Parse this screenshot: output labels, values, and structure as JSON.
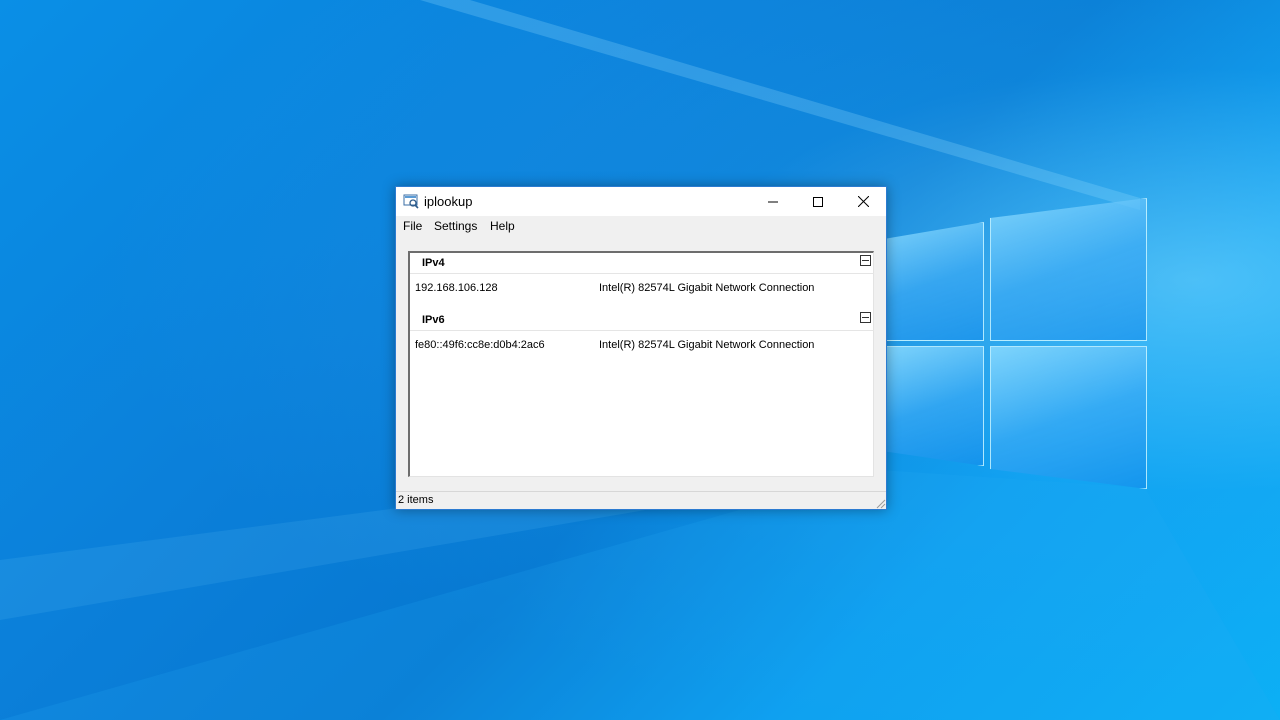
{
  "window": {
    "title": "iplookup",
    "app_icon": "iplookup-app-icon",
    "controls": {
      "minimize_icon": "minimize-icon",
      "maximize_icon": "maximize-icon",
      "close_icon": "close-icon"
    }
  },
  "menu": {
    "items": [
      {
        "label": "File"
      },
      {
        "label": "Settings"
      },
      {
        "label": "Help"
      }
    ]
  },
  "list": {
    "groups": [
      {
        "title": "IPv4",
        "rows": [
          {
            "address": "192.168.106.128",
            "adapter": "Intel(R) 82574L Gigabit Network Connection"
          }
        ]
      },
      {
        "title": "IPv6",
        "rows": [
          {
            "address": "fe80::49f6:cc8e:d0b4:2ac6",
            "adapter": "Intel(R) 82574L Gigabit Network Connection"
          }
        ]
      }
    ]
  },
  "status": {
    "text": "2 items"
  },
  "colors": {
    "desktop_blue": "#0a8fe6",
    "window_border": "#2b7bd1",
    "window_bg": "#f0f0f0"
  }
}
